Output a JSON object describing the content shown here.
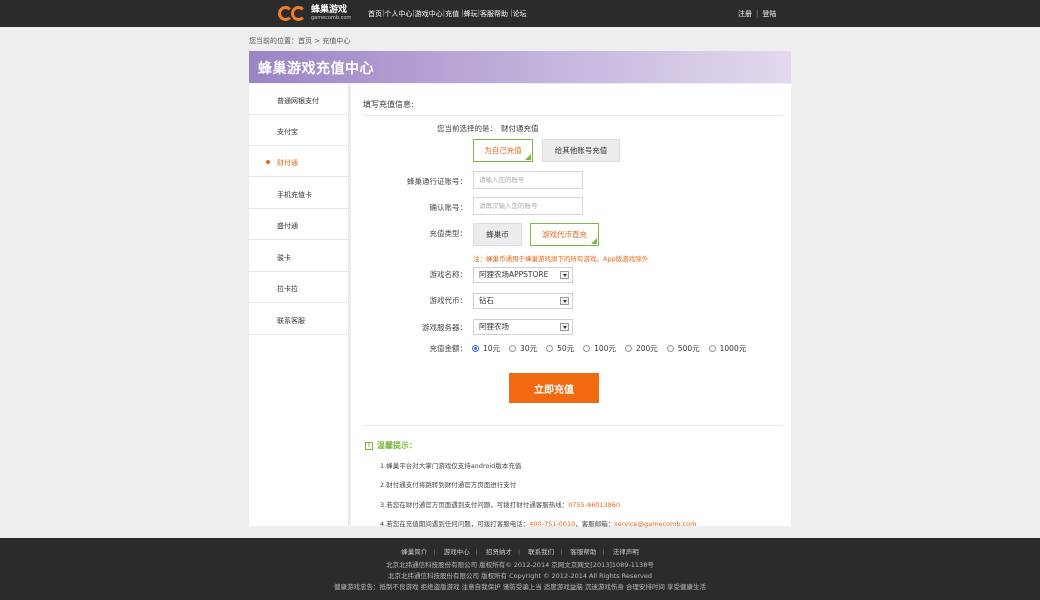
{
  "header": {
    "logo_cn": "蜂巢游戏",
    "logo_en": "gamecomb.com",
    "nav": [
      "首页",
      "个人中心",
      "游戏中心",
      "充值",
      "蜂玩",
      "客服帮助",
      "论坛"
    ],
    "register": "注册",
    "login": "登陆"
  },
  "breadcrumb": "您当前的位置：首页 > 充值中心",
  "banner_title": "蜂巢游戏充值中心",
  "sidebar": {
    "items": [
      {
        "label": "普通网银支付"
      },
      {
        "label": "支付宝"
      },
      {
        "label": "财付通"
      },
      {
        "label": "手机充值卡"
      },
      {
        "label": "盛付通"
      },
      {
        "label": "骏卡"
      },
      {
        "label": "拉卡拉"
      },
      {
        "label": "联系客服"
      }
    ],
    "active_index": 2
  },
  "form": {
    "section_title": "填写充值信息:",
    "selected_label": "您当前选择的是：",
    "selected_value": "财付通充值",
    "target_self": "为自己充值",
    "target_other": "给其他账号充值",
    "account_label": "蜂巢通行证账号：",
    "account_placeholder": "请输入您的账号",
    "confirm_label": "确认账号：",
    "confirm_placeholder": "请再次输入您的账号",
    "type_label": "充值类型：",
    "type_coin": "蜂巢币",
    "type_direct": "游戏代币直充",
    "note": "注：蜂巢币通用于蜂巢游戏旗下的所有游戏，App版游戏除外",
    "game_label": "游戏名称：",
    "game_value": "阿狸农场APPSTORE",
    "currency_label": "游戏代币：",
    "currency_value": "钻石",
    "server_label": "游戏服务器：",
    "server_value": "阿狸农场",
    "amount_label": "充值金额：",
    "amounts": [
      "10元",
      "30元",
      "50元",
      "100元",
      "200元",
      "500元",
      "1000元"
    ],
    "amount_selected": 0,
    "submit": "立即充值"
  },
  "tips": {
    "title": "温馨提示：",
    "t1": "1.蜂巢平台对大掌门游戏仅支持android版本充值",
    "t2": "2.财付通支付将跳转到财付通官方页面进行支付",
    "t3_pre": "3.若您在财付通官方页面遇到支付问题，可拨打财付通客服热线：",
    "t3_phone": "0755-86013860",
    "t4_pre": "4.若您在充值期间遇到任何问题，可拨打客服电话：",
    "t4_phone": "400-751-0010",
    "t4_mid": "，客服邮箱：",
    "t4_email": "service@gamecomb.com"
  },
  "footer": {
    "links": [
      "蜂巢简介",
      "游戏中心",
      "招贤纳才",
      "联系我们",
      "客服帮助",
      "法律声明"
    ],
    "line1": "北京北纬通信科技股份有限公司 版权所有© 2012-2014 京网文京网文[2013]1089-1138号",
    "line2": "北京北纬通信科技股份有限公司 版权所有 Copyright © 2012-2014 All Rights Reserved",
    "line3": "健康游戏忠告：抵制不良游戏 拒绝盗版游戏 注意自我保护 谨防受骗上当 适度游戏益脑 沉迷游戏伤身 合理安排时间 享受健康生活"
  }
}
